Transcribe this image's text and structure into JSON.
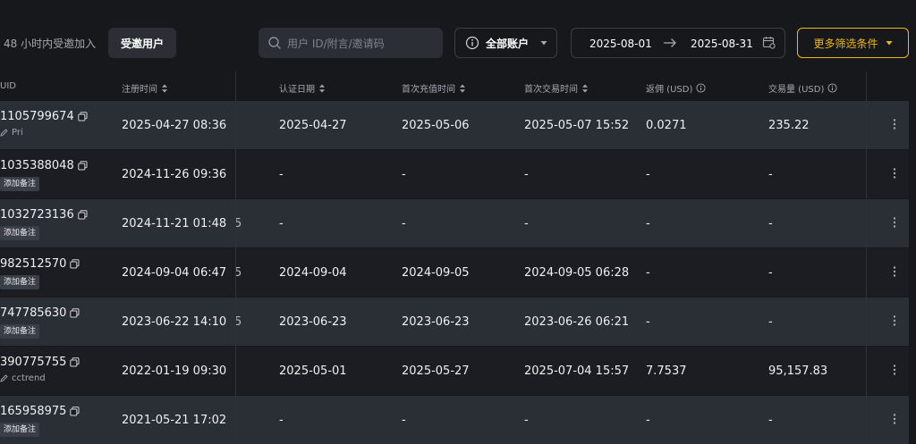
{
  "toolbar": {
    "recent_label": "48 小时内受邀加入",
    "invited_tab": "受邀用户",
    "search_placeholder": "用户 ID/附言/邀请码",
    "account_select": "全部账户",
    "date_from": "2025-08-01",
    "date_to": "2025-08-31",
    "more_filters": "更多筛选条件"
  },
  "columns": {
    "uid": "UID",
    "registered": "注册时间",
    "verified": "认证日期",
    "first_deposit": "首次充值时间",
    "first_trade": "首次交易时间",
    "rebate": "返佣 (USD)",
    "volume": "交易量 (USD)"
  },
  "rows": [
    {
      "uid": "1105799674",
      "note": "Pri",
      "note_type": "text",
      "registered": "2025-04-27 08:36",
      "ghost": "",
      "verified": "2025-04-27",
      "first_deposit": "2025-05-06",
      "first_trade": "2025-05-07 15:52",
      "rebate": "0.0271",
      "volume": "235.22"
    },
    {
      "uid": "1035388048",
      "note": "添加备注",
      "note_type": "tag",
      "registered": "2024-11-26 09:36",
      "ghost": "",
      "verified": "-",
      "first_deposit": "-",
      "first_trade": "-",
      "rebate": "-",
      "volume": "-"
    },
    {
      "uid": "1032723136",
      "note": "添加备注",
      "note_type": "tag",
      "registered": "2024-11-21 01:48",
      "ghost": "5",
      "verified": "-",
      "first_deposit": "-",
      "first_trade": "-",
      "rebate": "-",
      "volume": "-"
    },
    {
      "uid": "982512570",
      "note": "添加备注",
      "note_type": "tag",
      "registered": "2024-09-04 06:47",
      "ghost": "5",
      "verified": "2024-09-04",
      "first_deposit": "2024-09-05",
      "first_trade": "2024-09-05 06:28",
      "rebate": "-",
      "volume": "-"
    },
    {
      "uid": "747785630",
      "note": "添加备注",
      "note_type": "tag",
      "registered": "2023-06-22 14:10",
      "ghost": "5",
      "verified": "2023-06-23",
      "first_deposit": "2023-06-23",
      "first_trade": "2023-06-26 06:21",
      "rebate": "-",
      "volume": "-"
    },
    {
      "uid": "390775755",
      "note": "cctrend",
      "note_type": "text",
      "registered": "2022-01-19 09:30",
      "ghost": "",
      "verified": "2025-05-01",
      "first_deposit": "2025-05-27",
      "first_trade": "2025-07-04 15:57",
      "rebate": "7.7537",
      "volume": "95,157.83"
    },
    {
      "uid": "165958975",
      "note": "添加备注",
      "note_type": "tag",
      "registered": "2021-05-21 17:02",
      "ghost": "",
      "verified": "-",
      "first_deposit": "-",
      "first_trade": "-",
      "rebate": "-",
      "volume": "-"
    }
  ]
}
